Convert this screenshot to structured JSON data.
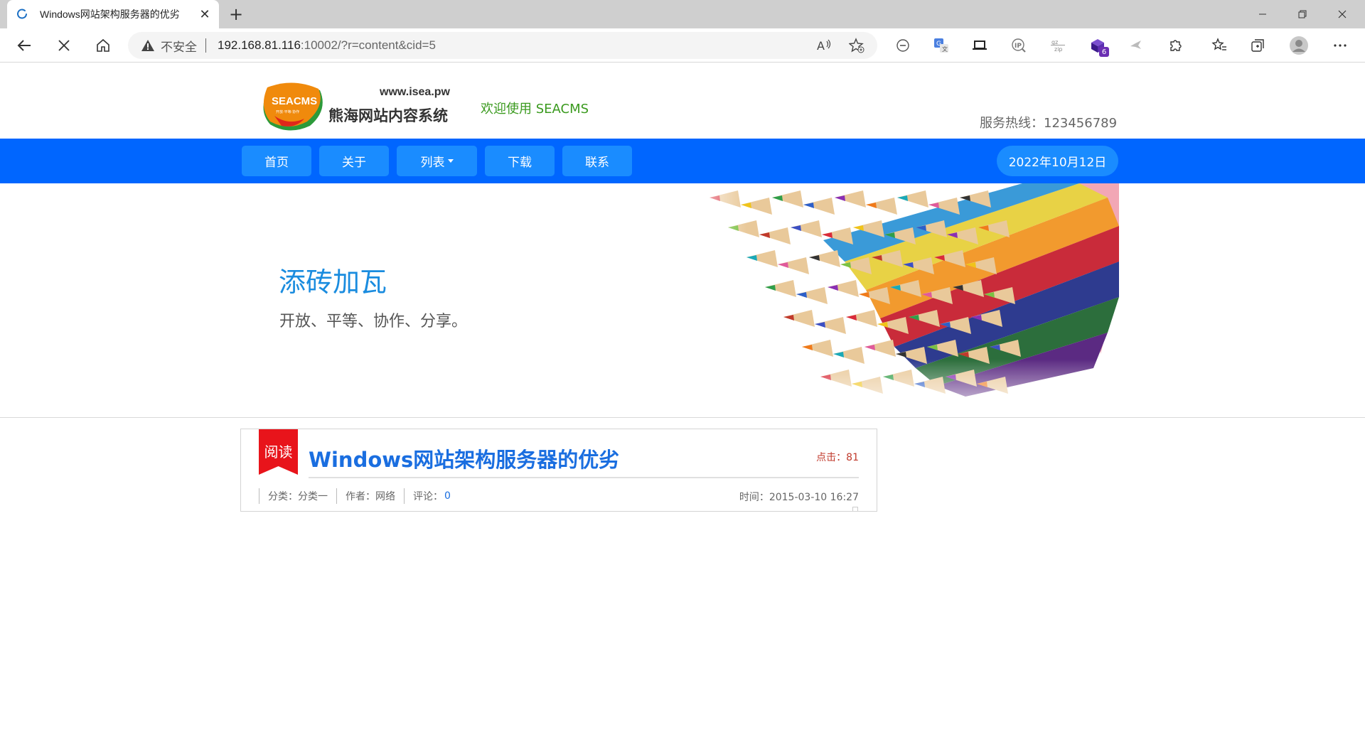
{
  "browser": {
    "tab_title": "Windows网站架构服务器的优劣",
    "url_warning": "不安全",
    "url_host": "192.168.81.116",
    "url_path": ":10002/?r=content&cid=5",
    "extension_badge": "6"
  },
  "header": {
    "logo_badge": "SEACMS",
    "logo_tagline": "开放·平等·协作",
    "logo_url": "www.isea.pw",
    "logo_name": "熊海网站内容系统",
    "welcome": "欢迎使用 SEACMS",
    "hotline": "服务热线：123456789"
  },
  "nav": {
    "items": [
      {
        "label": "首页"
      },
      {
        "label": "关于"
      },
      {
        "label": "列表"
      },
      {
        "label": "下载"
      },
      {
        "label": "联系"
      }
    ],
    "date": "2022年10月12日"
  },
  "banner": {
    "title": "添砖加瓦",
    "subtitle": "开放、平等、协作、分享。"
  },
  "article": {
    "ribbon": "阅读",
    "title": "Windows网站架构服务器的优劣",
    "hits": "点击：81",
    "category": "分类：分类一",
    "author": "作者：网络",
    "comments_label": "评论：",
    "comments_count": "0",
    "time": "时间：2015-03-10 16:27"
  },
  "colors": {
    "nav_bg": "#0066ff",
    "nav_item_bg": "#1a8cff",
    "banner_title": "#1a8cdf",
    "article_title": "#1a6ee0",
    "ribbon_red": "#e8141b",
    "welcome_green": "#3a9a1e"
  }
}
